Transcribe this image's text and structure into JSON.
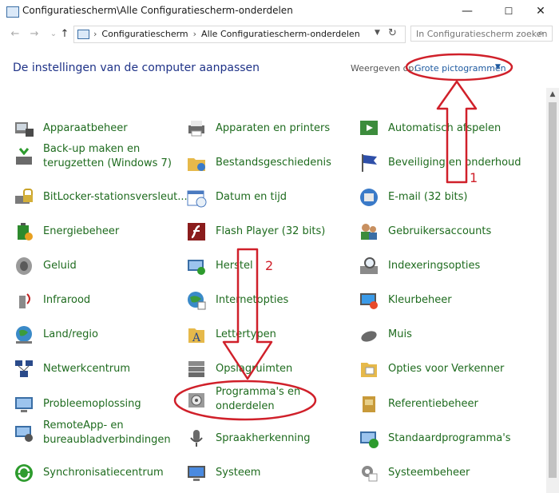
{
  "window": {
    "title": "Configuratiescherm\\Alle Configuratiescherm-onderdelen",
    "minimize": "—",
    "maximize": "☐",
    "close": "✕"
  },
  "nav": {
    "back": "←",
    "forward": "→",
    "up": "↑",
    "breadcrumbs": [
      "Configuratiescherm",
      "Alle Configuratiescherm-onderdelen"
    ],
    "search_placeholder": "In Configuratiescherm zoeken"
  },
  "header": {
    "title": "De instellingen van de computer aanpassen",
    "view_by_label": "Weergeven op:",
    "view_by_value": "Grote pictogrammen"
  },
  "items": [
    {
      "label": "Apparaatbeheer",
      "icon": "device-manager-icon"
    },
    {
      "label": "Apparaten en printers",
      "icon": "printer-icon"
    },
    {
      "label": "Automatisch afspelen",
      "icon": "autoplay-icon"
    },
    {
      "label": "Back-up maken en terugzetten (Windows 7)",
      "icon": "backup-icon"
    },
    {
      "label": "Bestandsgeschiedenis",
      "icon": "file-history-icon"
    },
    {
      "label": "Beveiliging en onderhoud",
      "icon": "flag-icon"
    },
    {
      "label": "BitLocker-stationsversleut...",
      "icon": "bitlocker-icon"
    },
    {
      "label": "Datum en tijd",
      "icon": "calendar-clock-icon"
    },
    {
      "label": "E-mail (32 bits)",
      "icon": "mail-icon"
    },
    {
      "label": "Energiebeheer",
      "icon": "battery-icon"
    },
    {
      "label": "Flash Player (32 bits)",
      "icon": "flash-icon"
    },
    {
      "label": "Gebruikersaccounts",
      "icon": "users-icon"
    },
    {
      "label": "Geluid",
      "icon": "speaker-icon"
    },
    {
      "label": "Herstel",
      "icon": "recovery-icon"
    },
    {
      "label": "Indexeringsopties",
      "icon": "index-icon"
    },
    {
      "label": "Infrarood",
      "icon": "infrared-icon"
    },
    {
      "label": "Internetopties",
      "icon": "globe-icon"
    },
    {
      "label": "Kleurbeheer",
      "icon": "color-icon"
    },
    {
      "label": "Land/regio",
      "icon": "region-icon"
    },
    {
      "label": "Lettertypen",
      "icon": "font-icon"
    },
    {
      "label": "Muis",
      "icon": "mouse-icon"
    },
    {
      "label": "Netwerkcentrum",
      "icon": "network-icon"
    },
    {
      "label": "Opslagruimten",
      "icon": "storage-icon"
    },
    {
      "label": "Opties voor Verkenner",
      "icon": "folder-options-icon"
    },
    {
      "label": "Probleemoplossing",
      "icon": "troubleshoot-icon"
    },
    {
      "label": "Programma's en onderdelen",
      "icon": "programs-icon"
    },
    {
      "label": "Referentiebeheer",
      "icon": "credential-icon"
    },
    {
      "label": "RemoteApp- en bureaubladverbindingen",
      "icon": "remote-icon"
    },
    {
      "label": "Spraakherkenning",
      "icon": "microphone-icon"
    },
    {
      "label": "Standaardprogramma's",
      "icon": "default-programs-icon"
    },
    {
      "label": "Synchronisatiecentrum",
      "icon": "sync-icon"
    },
    {
      "label": "Systeem",
      "icon": "system-icon"
    },
    {
      "label": "Systeembeheer",
      "icon": "admin-tools-icon"
    }
  ],
  "annotations": {
    "callout_1": "1",
    "callout_2": "2"
  },
  "colors": {
    "link": "#1e6b1e",
    "heading": "#1e3287",
    "annotation": "#d0202a"
  }
}
